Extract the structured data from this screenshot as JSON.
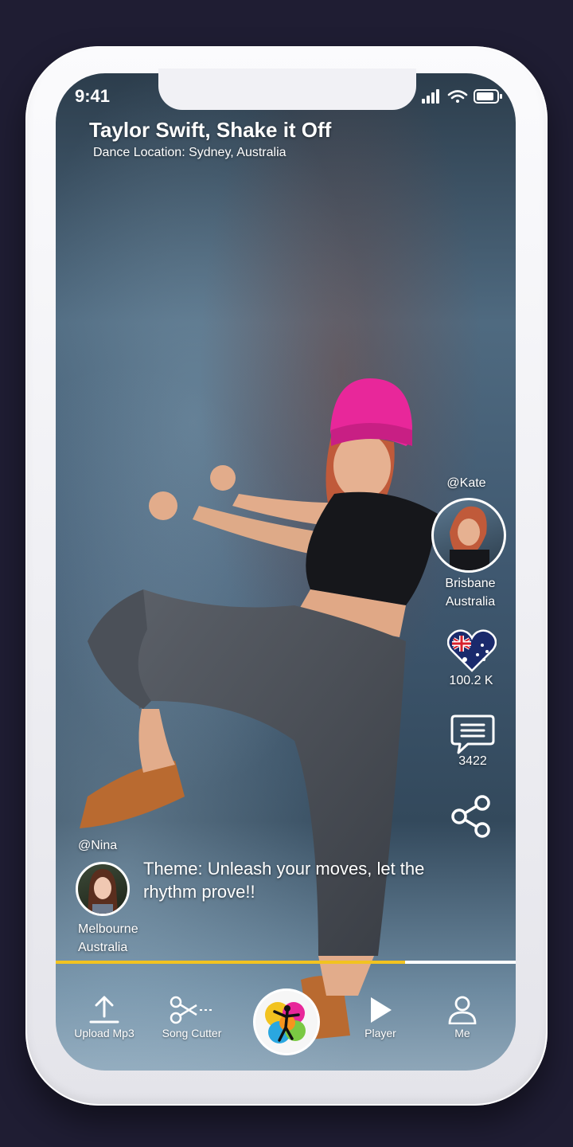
{
  "status_bar": {
    "time": "9:41"
  },
  "video": {
    "title": "Taylor Swift, Shake it Off",
    "location": "Dance Location: Sydney, Australia",
    "progress": 0.76
  },
  "creator": {
    "handle": "@Kate",
    "city": "Brisbane",
    "country": "Australia"
  },
  "stats": {
    "likes": "100.2 K",
    "comments": "3422"
  },
  "challenger": {
    "handle": "@Nina",
    "city": "Melbourne",
    "country": "Australia",
    "theme": "Theme: Unleash your moves, let the rhythm prove!!"
  },
  "bottom_nav": {
    "upload": "Upload Mp3",
    "cutter": "Song Cutter",
    "player": "Player",
    "me": "Me"
  },
  "colors": {
    "accent": "#f2c320",
    "hat": "#e8279a",
    "background": "#1f1d33"
  }
}
